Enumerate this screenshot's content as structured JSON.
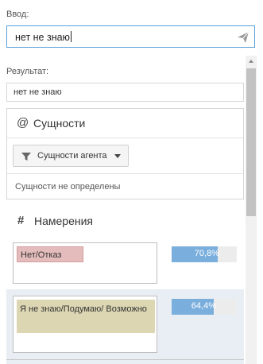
{
  "input": {
    "label": "Ввод:",
    "value": "нет не знаю"
  },
  "result": {
    "label": "Результат:",
    "value": "нет не знаю"
  },
  "entities": {
    "title": "Сущности",
    "filter_label": "Сущности агента",
    "empty_text": "Сущности не определены"
  },
  "intents": {
    "title": "Намерения",
    "items": [
      {
        "name": "Нет/Отказ",
        "score_text": "70,8%",
        "score": 0.708,
        "tag_color": "#e4bcbc"
      },
      {
        "name": "Я не знаю/Подумаю/ Возможно",
        "score_text": "64,4%",
        "score": 0.644,
        "tag_color": "#dcd6b2",
        "selected": true
      }
    ]
  },
  "colors": {
    "accent": "#5aa0d8",
    "bar": "#7aaedd"
  }
}
